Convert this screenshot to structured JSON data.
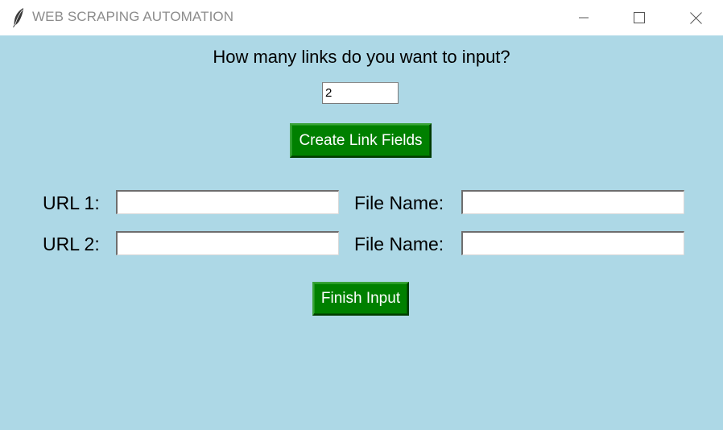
{
  "window": {
    "title": "WEB SCRAPING AUTOMATION",
    "app_icon": "feather-icon",
    "controls": {
      "minimize_icon": "minimize-icon",
      "maximize_icon": "maximize-icon",
      "close_icon": "close-icon"
    }
  },
  "form": {
    "prompt": "How many links do you want to input?",
    "link_count_value": "2",
    "create_button_label": "Create Link Fields",
    "rows": [
      {
        "url_label": "URL 1:",
        "url_value": "",
        "file_label": "File Name:",
        "file_value": ""
      },
      {
        "url_label": "URL 2:",
        "url_value": "",
        "file_label": "File Name:",
        "file_value": ""
      }
    ],
    "finish_button_label": "Finish Input"
  },
  "colors": {
    "background": "#add8e6",
    "button_bg": "#008000",
    "button_text": "#ffffff",
    "title_text": "#8c8c8c"
  }
}
